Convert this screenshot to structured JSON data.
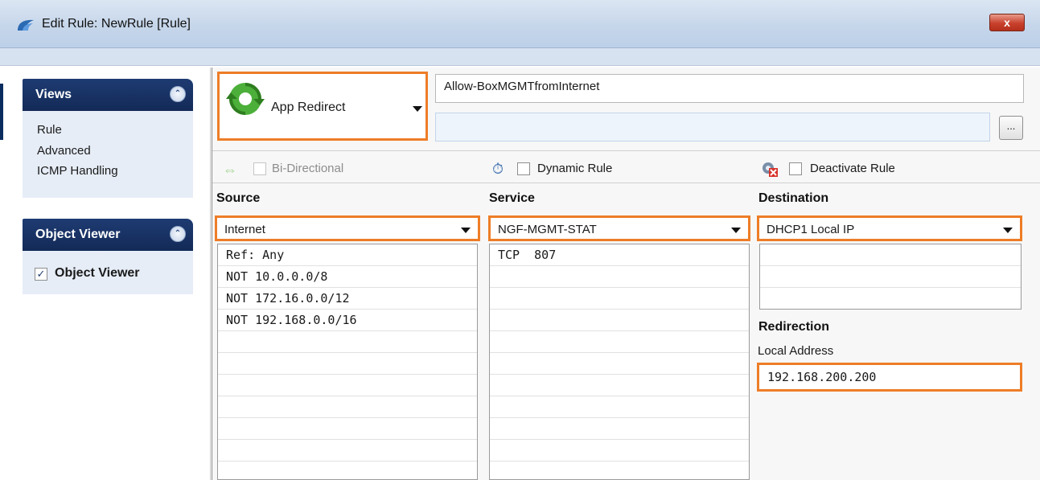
{
  "window": {
    "title": "Edit Rule: NewRule [Rule]",
    "close_label": "x"
  },
  "sidebar": {
    "views_title": "Views",
    "views_items": [
      "Rule",
      "Advanced",
      "ICMP Handling"
    ],
    "object_viewer_title": "Object Viewer",
    "object_viewer_checkbox_label": "Object Viewer",
    "object_viewer_checked": true
  },
  "action": {
    "label": "App Redirect",
    "rule_name": "Allow-BoxMGMTfromInternet",
    "rule_description": "",
    "browse_label": "..."
  },
  "options": {
    "bidirectional_label": "Bi-Directional",
    "bidirectional_enabled": false,
    "dynamic_rule_label": "Dynamic Rule",
    "deactivate_rule_label": "Deactivate Rule"
  },
  "source": {
    "heading": "Source",
    "selected": "Internet",
    "items": [
      "Ref: Any",
      "NOT 10.0.0.0/8",
      "NOT 172.16.0.0/12",
      "NOT 192.168.0.0/16",
      "",
      "",
      "",
      "",
      "",
      "",
      ""
    ]
  },
  "service": {
    "heading": "Service",
    "selected": "NGF-MGMT-STAT",
    "items": [
      "TCP  807",
      "",
      "",
      "",
      "",
      "",
      "",
      "",
      "",
      "",
      ""
    ]
  },
  "destination": {
    "heading": "Destination",
    "selected": "DHCP1 Local IP",
    "items": [
      "",
      "",
      ""
    ]
  },
  "redirection": {
    "heading": "Redirection",
    "local_address_label": "Local Address",
    "local_address_value": "192.168.200.200"
  },
  "colors": {
    "highlight": "#ee7d27",
    "panel_header": "#1e3b72",
    "panel_body": "#e6edf7"
  }
}
